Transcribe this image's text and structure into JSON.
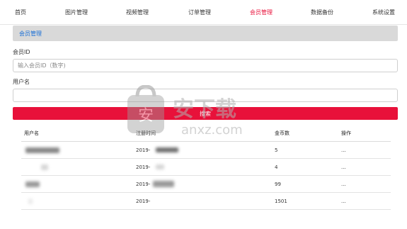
{
  "nav": {
    "items": [
      {
        "label": "首页"
      },
      {
        "label": "图片管理"
      },
      {
        "label": "视频管理"
      },
      {
        "label": "订单管理"
      },
      {
        "label": "会员管理",
        "active": true
      },
      {
        "label": "数据备份"
      },
      {
        "label": "系统设置"
      }
    ]
  },
  "breadcrumb": {
    "text": "会员管理"
  },
  "form": {
    "member_id_label": "会员ID",
    "member_id_placeholder": "输入会员ID（数字)",
    "username_label": "用户名",
    "username_value": "",
    "search_label": "搜索"
  },
  "table": {
    "headers": [
      "用户名",
      "注册时间",
      "金币数",
      "操作"
    ],
    "rows": [
      {
        "username": "",
        "reg_time": "2019-",
        "coins": "5",
        "action": "..."
      },
      {
        "username": "",
        "reg_time": "2019-",
        "coins": "4",
        "action": "..."
      },
      {
        "username": "",
        "reg_time": "2019-",
        "coins": "99",
        "action": "..."
      },
      {
        "username": "",
        "reg_time": "2019-",
        "coins": "1501",
        "action": "..."
      }
    ]
  },
  "watermark": {
    "text": "anxz.com"
  },
  "colors": {
    "accent": "#e8113a",
    "link": "#1a6fd6",
    "breadcrumb_bg": "#d9d9d9"
  }
}
